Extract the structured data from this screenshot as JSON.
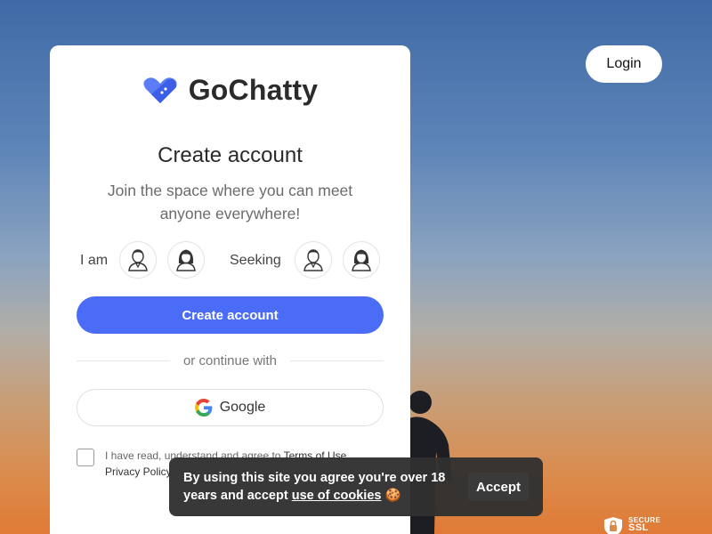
{
  "header": {
    "login_label": "Login"
  },
  "card": {
    "brand_name": "GoChatty",
    "title": "Create account",
    "subtitle": "Join the space where you can meet anyone everywhere!",
    "i_am_label": "I am",
    "seeking_label": "Seeking",
    "create_button_label": "Create account",
    "divider_text": "or continue with",
    "google_button_label": "Google",
    "terms_prefix": "I have read, understand and agree to ",
    "terms_link": "Terms of Use",
    "privacy_link": "Privacy Policy"
  },
  "cookie_banner": {
    "text_part1": "By using this site you agree you're over 18 years and accept ",
    "link_text": "use of cookies",
    "emoji": "🍪",
    "accept_label": "Accept"
  },
  "badge": {
    "line1": "SECURE",
    "line2": "SSL"
  },
  "colors": {
    "primary": "#4a6cf7",
    "brand_logo": "#5b7cf5",
    "cookie_bg": "#303030"
  }
}
